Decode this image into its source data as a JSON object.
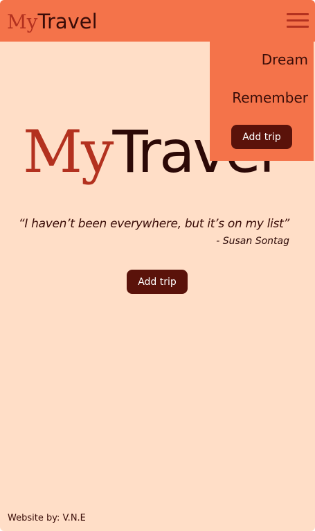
{
  "header": {
    "brand_my": "My",
    "brand_travel": "Travel",
    "menu_icon": "hamburger-menu-icon"
  },
  "menu": {
    "items": [
      {
        "label": "Dream"
      },
      {
        "label": "Remember"
      }
    ],
    "add_trip_label": "Add trip"
  },
  "hero": {
    "title_my": "My",
    "title_travel": "Travel",
    "quote": "“I haven’t been everywhere, but it’s on my list”",
    "author": "- Susan Sontag",
    "add_trip_label": "Add trip"
  },
  "footer": {
    "text": "Website by: V.N.E"
  },
  "colors": {
    "page_bg": "#ffdec7",
    "header_bg": "#f4734a",
    "brand_red": "#b3311f",
    "dark_text": "#3a0d08",
    "button_bg": "#5a120a"
  }
}
